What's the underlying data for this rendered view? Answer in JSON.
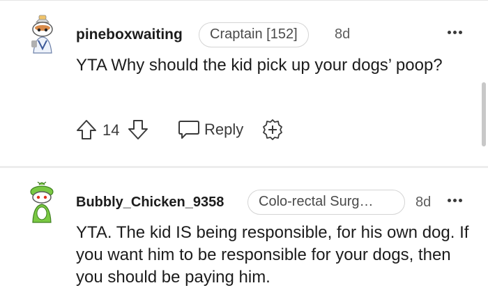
{
  "comments": [
    {
      "username": "pineboxwaiting",
      "flair": "Craptain [152]",
      "time": "8d",
      "body": "YTA Why should the kid pick up your dogs’ poop?",
      "score": "14",
      "reply_label": "Reply",
      "avatar_icon": "snoo-avatar-icon"
    },
    {
      "username": "Bubbly_Chicken_9358",
      "flair": "Colo-rectal Surg…",
      "time": "8d",
      "body": "YTA. The kid IS being responsible, for his own dog. If you want him to be responsible for your dogs, then you should be paying him.",
      "avatar_icon": "snoo-avatar-icon"
    }
  ],
  "colors": {
    "text": "#1c1c1c",
    "meta": "#5c5c5c",
    "border": "#d4d4d4",
    "divider": "#ededed"
  }
}
